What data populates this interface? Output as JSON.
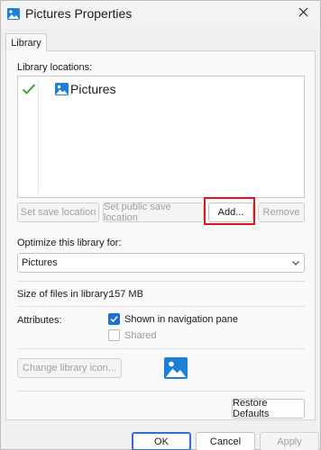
{
  "window": {
    "title": "Pictures Properties",
    "title_icon": "pictures-library-icon",
    "close_icon": "close-icon"
  },
  "tabs": [
    {
      "label": "Library",
      "selected": true
    }
  ],
  "library": {
    "locations_label": "Library locations:",
    "locations": [
      {
        "name": "Pictures",
        "is_default_save": true,
        "icon": "pictures-folder-icon"
      }
    ],
    "buttons": {
      "set_save": "Set save location",
      "set_public_save": "Set public save location",
      "add": "Add...",
      "remove": "Remove"
    },
    "optimize_label": "Optimize this library for:",
    "optimize_value": "Pictures",
    "size_label": "Size of files in library:",
    "size_value": "157 MB",
    "attributes_label": "Attributes:",
    "attributes": {
      "shown_in_nav": {
        "label": "Shown in navigation pane",
        "checked": true
      },
      "shared": {
        "label": "Shared",
        "checked": false
      }
    },
    "change_icon_label": "Change library icon...",
    "restore_defaults": "Restore Defaults"
  },
  "footer": {
    "ok": "OK",
    "cancel": "Cancel",
    "apply": "Apply"
  },
  "colors": {
    "accent": "#1f6fd1",
    "highlight": "#e3121b",
    "check": "#3aa53a"
  }
}
